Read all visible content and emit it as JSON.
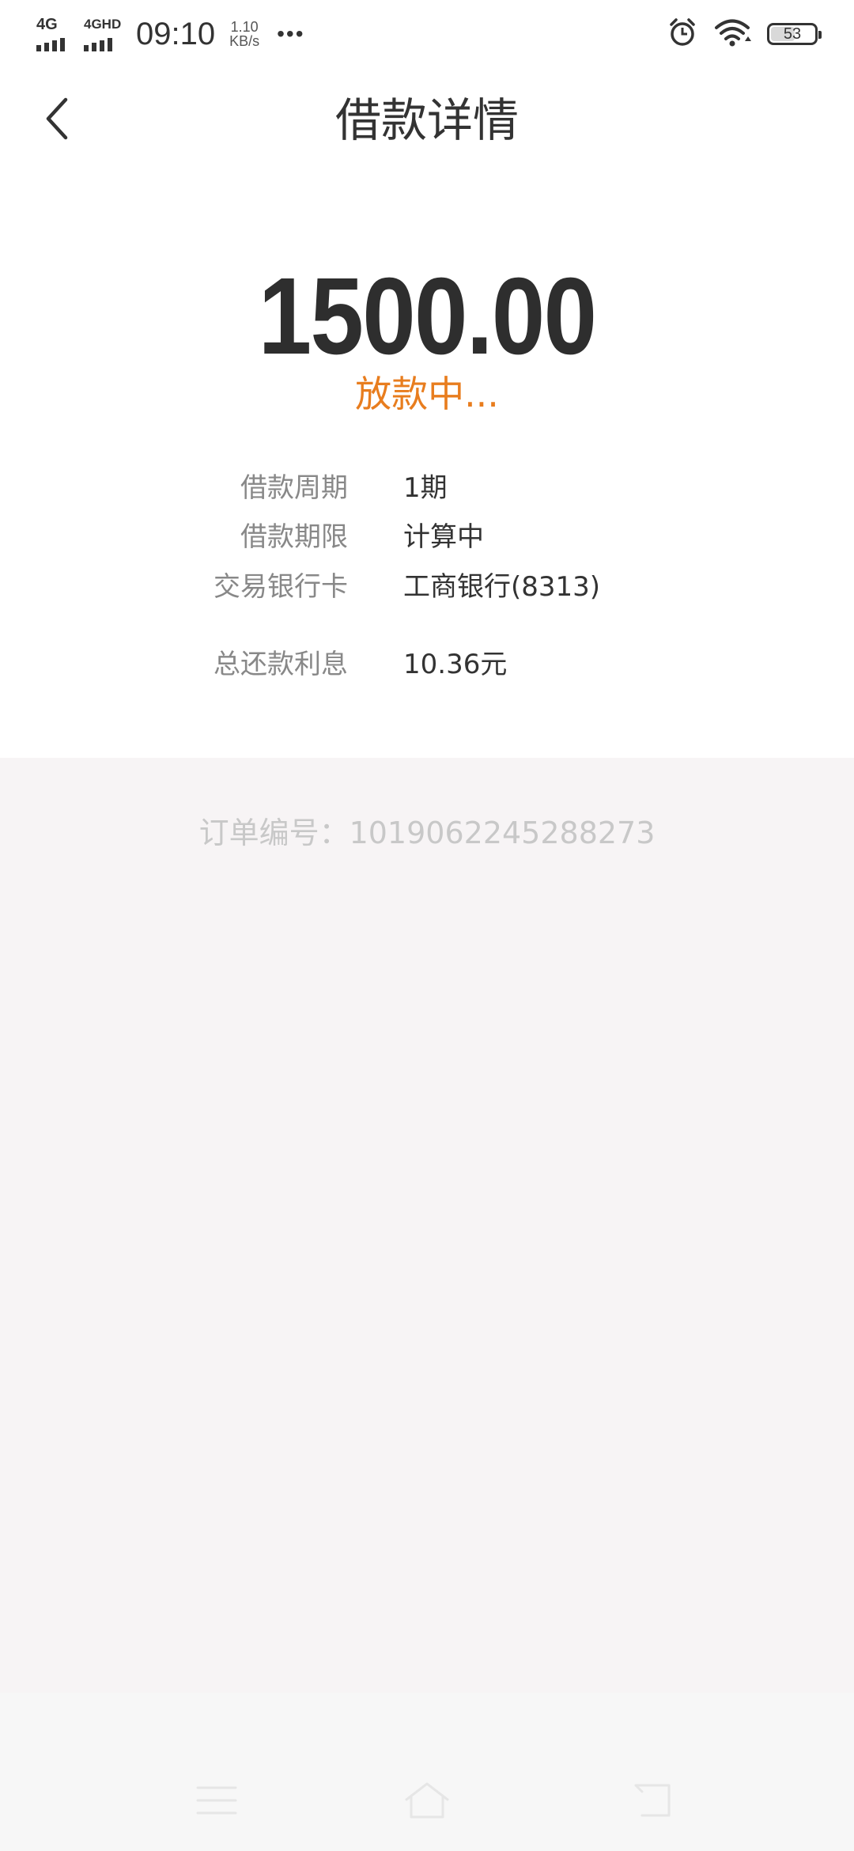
{
  "status_bar": {
    "sim1_label": "4G",
    "sim2_label": "4GHD",
    "time": "09:10",
    "speed_value": "1.10",
    "speed_unit": "KB/s",
    "more_dots": "•••",
    "battery_level": "53"
  },
  "header": {
    "title": "借款详情",
    "back_icon": "chevron-left-icon"
  },
  "loan": {
    "amount": "1500.00",
    "status": "放款中...",
    "status_color": "#e87d1e",
    "details": [
      {
        "label": "借款周期",
        "value": "1期"
      },
      {
        "label": "借款期限",
        "value": "计算中"
      },
      {
        "label": "交易银行卡",
        "value": "工商银行(8313)"
      },
      {
        "label": "总还款利息",
        "value": "10.36元"
      }
    ]
  },
  "order": {
    "text": "订单编号：1019062245288273"
  },
  "nav_bar": {
    "menu_icon": "menu-icon",
    "home_icon": "home-icon",
    "back_icon": "back-icon"
  }
}
